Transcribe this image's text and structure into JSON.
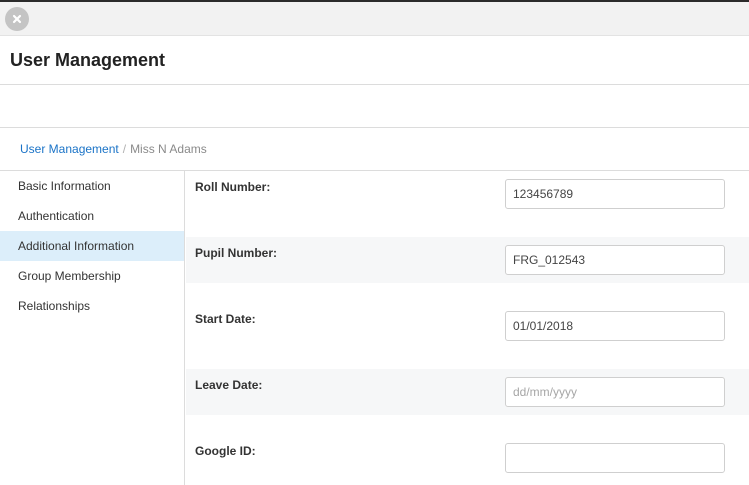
{
  "header": {
    "close_icon": "close-icon",
    "title": "User Management"
  },
  "breadcrumb": {
    "link": "User Management",
    "separator": "/",
    "current": "Miss N Adams"
  },
  "sidebar": {
    "items": [
      {
        "label": "Basic Information",
        "active": false
      },
      {
        "label": "Authentication",
        "active": false
      },
      {
        "label": "Additional Information",
        "active": true
      },
      {
        "label": "Group Membership",
        "active": false
      },
      {
        "label": "Relationships",
        "active": false
      }
    ]
  },
  "form": {
    "fields": [
      {
        "label": "Roll Number:",
        "value": "123456789",
        "placeholder": ""
      },
      {
        "label": "Pupil Number:",
        "value": "FRG_012543",
        "placeholder": ""
      },
      {
        "label": "Start Date:",
        "value": "01/01/2018",
        "placeholder": ""
      },
      {
        "label": "Leave Date:",
        "value": "",
        "placeholder": "dd/mm/yyyy"
      },
      {
        "label": "Google ID:",
        "value": "",
        "placeholder": ""
      }
    ]
  },
  "colors": {
    "link": "#1a73c7",
    "active_item_bg": "#dceefa",
    "shaded_row_bg": "#f6f7f8"
  }
}
